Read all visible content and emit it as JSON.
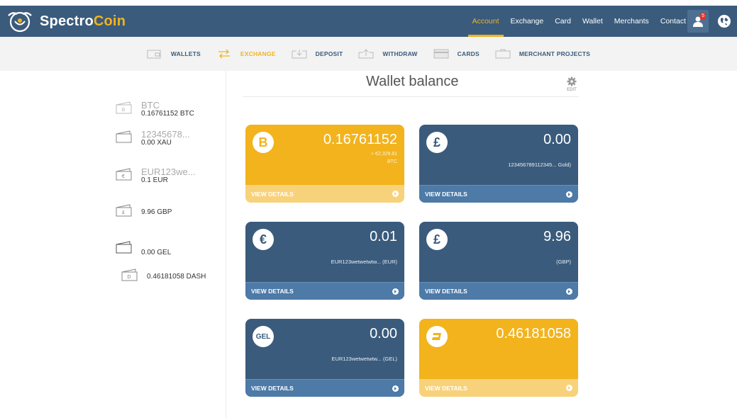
{
  "brand": {
    "name_part1": "Spectro",
    "name_part2": "Coin"
  },
  "topnav": {
    "items": [
      "Account",
      "Exchange",
      "Card",
      "Wallet",
      "Merchants",
      "Contact"
    ],
    "active": "Account",
    "notification_count": "5"
  },
  "subnav": {
    "wallets": "WALLETS",
    "exchange": "EXCHANGE",
    "deposit": "DEPOSIT",
    "withdraw": "WITHDRAW",
    "cards": "CARDS",
    "merchant_projects": "MERCHANT PROJECTS"
  },
  "sidebar": {
    "wallets": [
      {
        "name": "BTC",
        "balance": "0.16761152 BTC",
        "icon": "bitcoin-wallet-icon"
      },
      {
        "name": "12345678...",
        "balance": "0.00 XAU",
        "icon": "wallet-icon"
      },
      {
        "name": "EUR123we...",
        "balance": "0.1 EUR",
        "icon": "euro-wallet-icon"
      },
      {
        "name": "",
        "balance": "9.96 GBP",
        "icon": "pound-wallet-icon"
      },
      {
        "name": "",
        "balance": "0.00 GEL",
        "icon": "wallet-icon"
      },
      {
        "name": "",
        "balance": "0.46181058 DASH",
        "icon": "dash-wallet-icon"
      }
    ]
  },
  "main": {
    "title": "Wallet balance",
    "edit_label": "EDIT",
    "cards": [
      {
        "icon": "B",
        "amount": "0.16761152",
        "sub1": "≈ €2,329.81",
        "sub2": "BTC",
        "note": "",
        "footer": "VIEW DETAILS",
        "color": "#f2b31d"
      },
      {
        "icon": "£",
        "amount": "0.00",
        "sub1": "",
        "sub2": "",
        "note": "123456789112345... Gold)",
        "footer": "VIEW DETAILS",
        "color": "#3a5b7c"
      },
      {
        "icon": "€",
        "amount": "0.01",
        "sub1": "",
        "sub2": "",
        "note": "EUR123wetwetwtw... (EUR)",
        "footer": "VIEW DETAILS",
        "color": "#3a5b7c"
      },
      {
        "icon": "£",
        "amount": "9.96",
        "sub1": "",
        "sub2": "",
        "note": "(GBP)",
        "footer": "VIEW DETAILS",
        "color": "#3a5b7c"
      },
      {
        "icon": "GEL",
        "amount": "0.00",
        "sub1": "",
        "sub2": "",
        "note": "EUR123wetwetwtw... (GEL)",
        "footer": "VIEW DETAILS",
        "color": "#3a5b7c"
      },
      {
        "icon": "D",
        "amount": "0.46181058",
        "sub1": "",
        "sub2": "",
        "note": "",
        "footer": "VIEW DETAILS",
        "color": "#f2b31d"
      }
    ]
  },
  "colors": {
    "navy": "#3a5b7c",
    "gold": "#f2b31d",
    "footer_blue": "#4d7aa7",
    "footer_gold": "#f8d27a"
  }
}
